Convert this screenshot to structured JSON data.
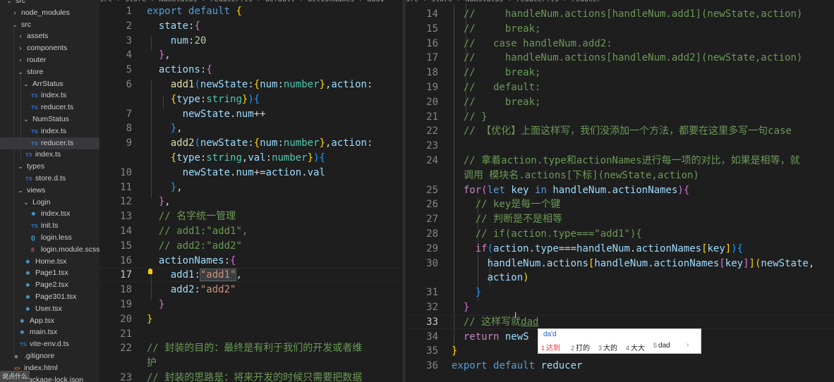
{
  "breadcrumb_left": "src › store › NumStatus › reducer.ts › default › actionNames › add1",
  "breadcrumb_right": "src › store › NumStatus › reducer.ts › reducer",
  "explorer": [
    {
      "name": "src-root",
      "label": "src",
      "depth": 0,
      "type": "folder"
    },
    {
      "name": "node_modules",
      "label": "node_modules",
      "depth": 1,
      "type": "folder-closed"
    },
    {
      "name": "src",
      "label": "src",
      "depth": 1,
      "type": "folder-open"
    },
    {
      "name": "assets",
      "label": "assets",
      "depth": 2,
      "type": "folder-closed"
    },
    {
      "name": "components",
      "label": "components",
      "depth": 2,
      "type": "folder-closed"
    },
    {
      "name": "router",
      "label": "router",
      "depth": 2,
      "type": "folder-closed"
    },
    {
      "name": "store",
      "label": "store",
      "depth": 2,
      "type": "folder-open"
    },
    {
      "name": "ArrStatus",
      "label": "ArrStatus",
      "depth": 3,
      "type": "folder-open"
    },
    {
      "name": "arr-index",
      "label": "index.ts",
      "depth": 4,
      "type": "ts"
    },
    {
      "name": "arr-reducer",
      "label": "reducer.ts",
      "depth": 4,
      "type": "ts"
    },
    {
      "name": "NumStatus",
      "label": "NumStatus",
      "depth": 3,
      "type": "folder-open"
    },
    {
      "name": "num-index",
      "label": "index.ts",
      "depth": 4,
      "type": "ts"
    },
    {
      "name": "num-reducer",
      "label": "reducer.ts",
      "depth": 4,
      "type": "ts",
      "selected": true
    },
    {
      "name": "store-index",
      "label": "index.ts",
      "depth": 3,
      "type": "ts"
    },
    {
      "name": "types",
      "label": "types",
      "depth": 2,
      "type": "folder-open"
    },
    {
      "name": "store-d",
      "label": "store.d.ts",
      "depth": 3,
      "type": "ts"
    },
    {
      "name": "views",
      "label": "views",
      "depth": 2,
      "type": "folder-open"
    },
    {
      "name": "Login",
      "label": "Login",
      "depth": 3,
      "type": "folder-open"
    },
    {
      "name": "login-index",
      "label": "index.tsx",
      "depth": 4,
      "type": "tsx"
    },
    {
      "name": "login-init",
      "label": "init.ts",
      "depth": 4,
      "type": "ts"
    },
    {
      "name": "login-less",
      "label": "login.less",
      "depth": 4,
      "type": "less"
    },
    {
      "name": "login-scss",
      "label": "login.module.scss",
      "depth": 4,
      "type": "scss"
    },
    {
      "name": "home",
      "label": "Home.tsx",
      "depth": 3,
      "type": "tsx"
    },
    {
      "name": "page1",
      "label": "Page1.tsx",
      "depth": 3,
      "type": "tsx"
    },
    {
      "name": "page2",
      "label": "Page2.tsx",
      "depth": 3,
      "type": "tsx"
    },
    {
      "name": "page301",
      "label": "Page301.tsx",
      "depth": 3,
      "type": "tsx"
    },
    {
      "name": "user",
      "label": "User.tsx",
      "depth": 3,
      "type": "tsx"
    },
    {
      "name": "app",
      "label": "App.tsx",
      "depth": 2,
      "type": "tsx"
    },
    {
      "name": "main",
      "label": "main.tsx",
      "depth": 2,
      "type": "tsx"
    },
    {
      "name": "vite-env",
      "label": "vite-env.d.ts",
      "depth": 2,
      "type": "ts"
    },
    {
      "name": "gitignore",
      "label": ".gitignore",
      "depth": 1,
      "type": "git"
    },
    {
      "name": "index-html",
      "label": "index.html",
      "depth": 1,
      "type": "html"
    },
    {
      "name": "pkg-lock",
      "label": "package-lock.json",
      "depth": 1,
      "type": "json"
    }
  ],
  "left_line_numbers": [
    "1",
    "2",
    "3",
    "4",
    "5",
    "6",
    "",
    "7",
    "8",
    "9",
    "",
    "10",
    "11",
    "12",
    "13",
    "14",
    "15",
    "16",
    "17",
    "18",
    "19",
    "20",
    "21",
    "22",
    "",
    "23"
  ],
  "left_active_line": "17",
  "right_line_numbers": [
    "14",
    "15",
    "16",
    "17",
    "18",
    "19",
    "20",
    "21",
    "22",
    "23",
    "24",
    "",
    "25",
    "26",
    "27",
    "28",
    "29",
    "30",
    "",
    "31",
    "32",
    "33",
    "34",
    "35",
    "36"
  ],
  "right_active_line": "33",
  "left_code_text": [
    "export default {",
    "  state:{",
    "    num:20",
    "  },",
    "  actions:{",
    "    add1(newState:{num:number},action:",
    "    {type:string}){",
    "      newState.num++",
    "    },",
    "    add2(newState:{num:number},action:",
    "    {type:string,val:number}){",
    "      newState.num+=action.val",
    "    },",
    "  },",
    "  // 名字统一管理",
    "  // add1:\"add1\",",
    "  // add2:\"add2\"",
    "  actionNames:{",
    "    add1:\"add1\",",
    "    add2:\"add2\"",
    "  }",
    "}",
    "",
    "// 封装的目的：最终是有利于我们的开发或者维",
    "护",
    "// 封装的思路是：将来开发的时候只需要把数据"
  ],
  "right_code_text": [
    "    //     handleNum.actions[handleNum.add1](newState,action)",
    "    //     break;",
    "    //   case handleNum.add2:",
    "    //     handleNum.actions[handleNum.add2](newState,action)",
    "    //     break;",
    "    //   default:",
    "    //     break;",
    "    // }",
    "    // 【优化】上面这样写，我们没添加一个方法，都要在这里多写一句case",
    "",
    "    // 拿着action.type和actionNames进行每一项的对比，如果是相等，就",
    "    调用 模块名.actions[下标](newState,action)",
    "    for(let key in handleNum.actionNames){",
    "      // key是每一个键",
    "      // 判断是不是相等",
    "      // if(action.type===\"add1\"){",
    "      if(action.type===handleNum.actionNames[key]){",
    "        handleNum.actions[handleNum.actionNames[key]](newState,",
    "        action)",
    "      }",
    "    }",
    "    // 这样写就dad",
    "    return newS",
    "}",
    "export default reducer"
  ],
  "ime": {
    "composition": "da'd",
    "candidates": [
      {
        "num": "1",
        "text": "达到"
      },
      {
        "num": "2",
        "text": "打的"
      },
      {
        "num": "3",
        "text": "大的"
      },
      {
        "num": "4",
        "text": "大大"
      },
      {
        "num": "5",
        "text": "dad"
      }
    ],
    "more": "›"
  },
  "taskbar_snippet": "说点什么..."
}
